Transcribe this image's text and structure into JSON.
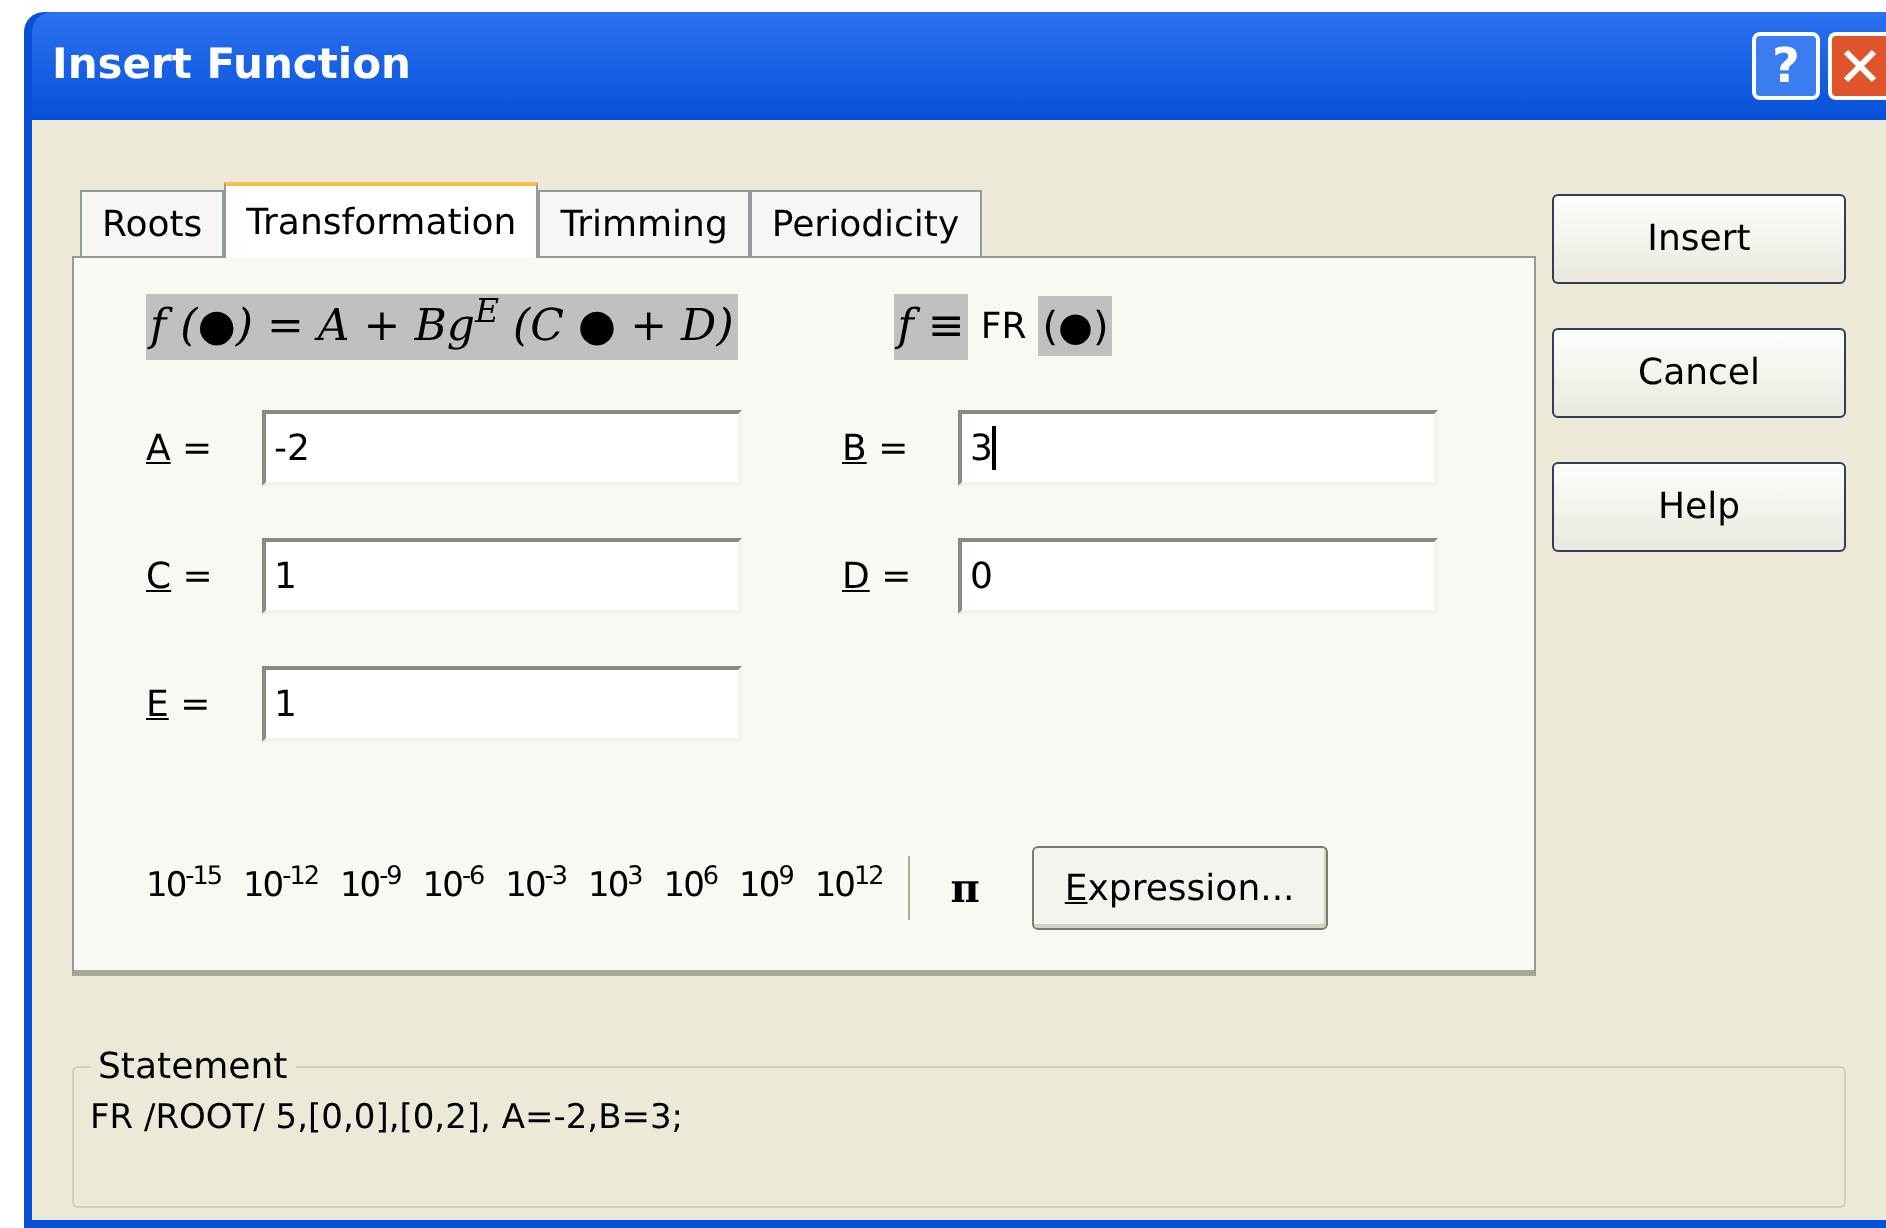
{
  "window": {
    "title": "Insert Function"
  },
  "title_buttons": [
    {
      "kind": "help",
      "label": "?"
    },
    {
      "kind": "close"
    }
  ],
  "tabs": [
    {
      "label": "Roots",
      "selected": false
    },
    {
      "label": "Transformation",
      "selected": true
    },
    {
      "label": "Trimming",
      "selected": false
    },
    {
      "label": "Periodicity",
      "selected": false
    }
  ],
  "formula": "f (●) = A + Bg$^{E}$ (C ● + D)",
  "identity": {
    "symbol": "f ≡",
    "name": "FR",
    "argument": "(●)"
  },
  "fields": [
    {
      "label": "A =",
      "value": "-2",
      "focused": false
    },
    {
      "label": "B =",
      "value": "3",
      "focused": true
    },
    {
      "label": "C =",
      "value": "1",
      "focused": false
    },
    {
      "label": "D =",
      "value": "0",
      "focused": false
    },
    {
      "label": "E =",
      "value": "1",
      "focused": false
    }
  ],
  "powers": [
    "10$^{-15}$",
    "10$^{-12}$",
    "10$^{-9}$",
    "10$^{-6}$",
    "10$^{-3}$",
    "10$^{3}$",
    "10$^{6}$",
    "10$^{9}$",
    "10$^{12}$"
  ],
  "pi": "π",
  "expression_button": "Expression...",
  "buttons": [
    "Insert",
    "Cancel",
    "Help"
  ],
  "statement": {
    "legend": "Statement",
    "text": "FR /ROOT/ 5,[0,0],[0,2], A=-2,B=3;"
  }
}
